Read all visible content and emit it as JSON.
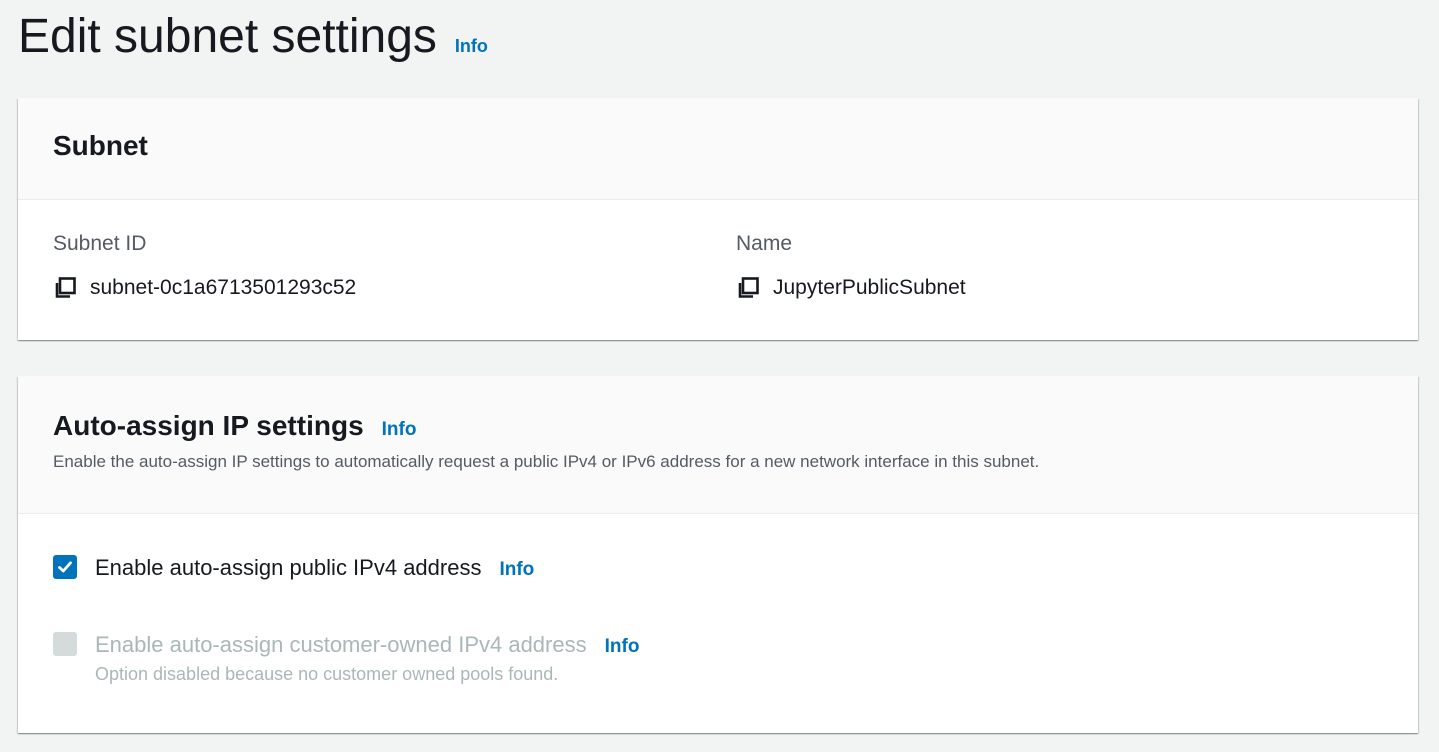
{
  "page": {
    "title": "Edit subnet settings",
    "info_label": "Info"
  },
  "subnet_panel": {
    "heading": "Subnet",
    "subnet_id_label": "Subnet ID",
    "subnet_id_value": "subnet-0c1a6713501293c52",
    "name_label": "Name",
    "name_value": "JupyterPublicSubnet"
  },
  "auto_assign_panel": {
    "heading": "Auto-assign IP settings",
    "info_label": "Info",
    "description": "Enable the auto-assign IP settings to automatically request a public IPv4 or IPv6 address for a new network interface in this subnet.",
    "options": [
      {
        "label": "Enable auto-assign public IPv4 address",
        "info_label": "Info",
        "checked": true,
        "disabled": false
      },
      {
        "label": "Enable auto-assign customer-owned IPv4 address",
        "info_label": "Info",
        "checked": false,
        "disabled": true,
        "helper": "Option disabled because no customer owned pools found."
      }
    ]
  },
  "icons": {
    "copy": "copy-icon",
    "check": "checkmark-icon"
  },
  "colors": {
    "link": "#0073bb",
    "checkbox_checked": "#0073bb",
    "checkbox_disabled": "#d5dbdb",
    "disabled_text": "#aab7b8",
    "background": "#f2f3f3"
  }
}
